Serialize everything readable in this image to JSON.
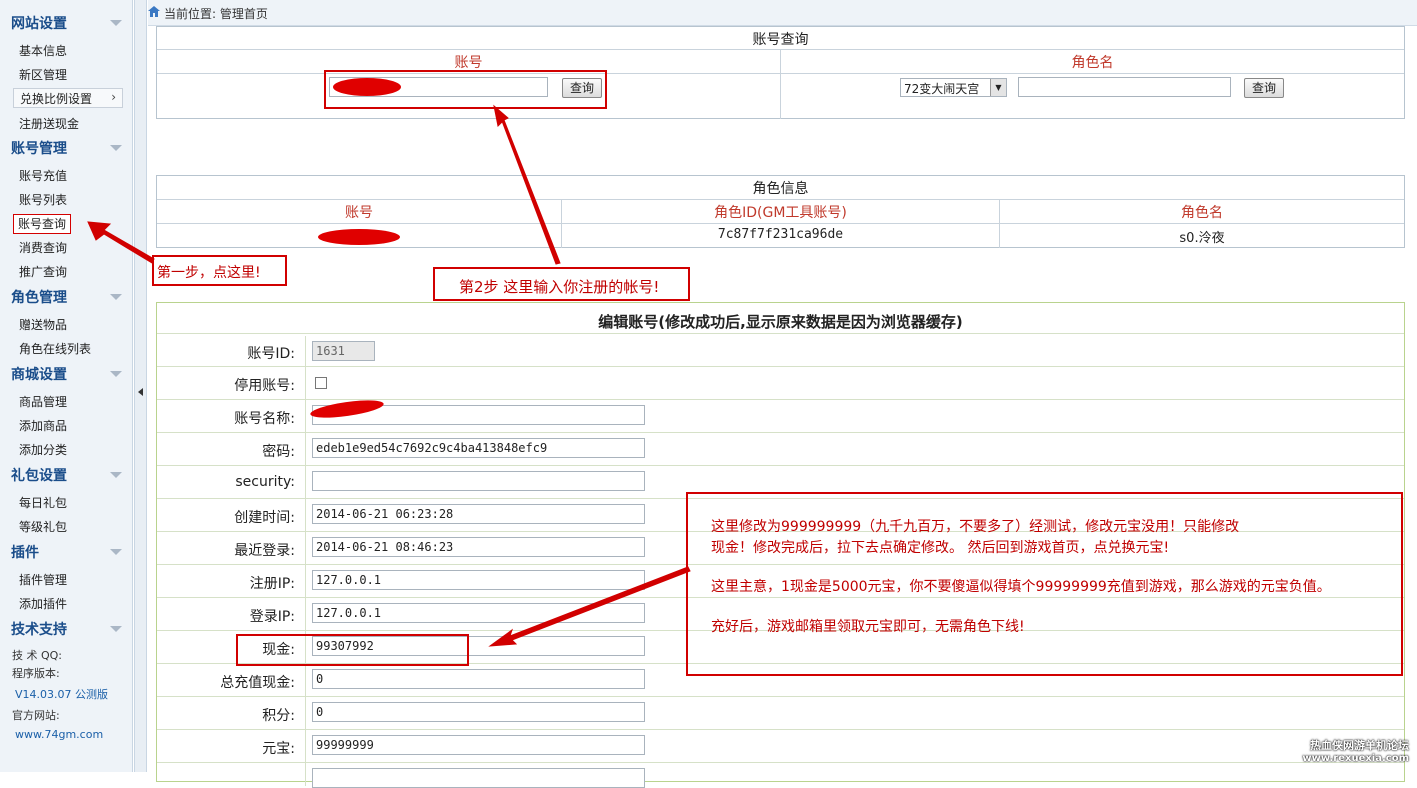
{
  "sidebar": {
    "sections": [
      {
        "title": "网站设置",
        "items": [
          "基本信息",
          "新区管理",
          "兑换比例设置",
          "注册送现金"
        ]
      },
      {
        "title": "账号管理",
        "items": [
          "账号充值",
          "账号列表",
          "账号查询",
          "消费查询",
          "推广查询"
        ]
      },
      {
        "title": "角色管理",
        "items": [
          "赠送物品",
          "角色在线列表"
        ]
      },
      {
        "title": "商城设置",
        "items": [
          "商品管理",
          "添加商品",
          "添加分类"
        ]
      },
      {
        "title": "礼包设置",
        "items": [
          "每日礼包",
          "等级礼包"
        ]
      },
      {
        "title": "插件",
        "items": [
          "插件管理",
          "添加插件"
        ]
      },
      {
        "title": "技术支持",
        "items": []
      }
    ],
    "info": {
      "qq_label": "技 术 QQ:",
      "version_label": "程序版本:",
      "version": "V14.03.07 公测版",
      "site_label": "官方网站:",
      "site": "www.74gm.com"
    }
  },
  "breadcrumb": "当前位置: 管理首页",
  "account_query": {
    "title": "账号查询",
    "col_account": "账号",
    "col_role": "角色名",
    "query_button": "查询",
    "server_select": "72变大闹天宫",
    "role_input": ""
  },
  "role_info": {
    "title": "角色信息",
    "headers": [
      "账号",
      "角色ID(GM工具账号)",
      "角色名"
    ],
    "row": {
      "account": "",
      "role_id": "7c87f7f231ca96de",
      "role_name": "s0.泠夜"
    }
  },
  "edit": {
    "title": "编辑账号(修改成功后,显示原来数据是因为浏览器缓存)",
    "fields": [
      {
        "label": "账号ID:",
        "value": "1631"
      },
      {
        "label": "停用账号:",
        "value": ""
      },
      {
        "label": "账号名称:",
        "value": ""
      },
      {
        "label": "密码:",
        "value": "edeb1e9ed54c7692c9c4ba413848efc9"
      },
      {
        "label": "security:",
        "value": ""
      },
      {
        "label": "创建时间:",
        "value": "2014-06-21 06:23:28"
      },
      {
        "label": "最近登录:",
        "value": "2014-06-21 08:46:23"
      },
      {
        "label": "注册IP:",
        "value": "127.0.0.1"
      },
      {
        "label": "登录IP:",
        "value": "127.0.0.1"
      },
      {
        "label": "现金:",
        "value": "99307992"
      },
      {
        "label": "总充值现金:",
        "value": "0"
      },
      {
        "label": "积分:",
        "value": "0"
      },
      {
        "label": "元宝:",
        "value": "99999999"
      }
    ]
  },
  "annotations": {
    "step1": "第一步，点这里!",
    "step2": "第2步  这里输入你注册的帐号!",
    "note_line1": "这里修改为999999999（九千九百万，不要多了）经测试，修改元宝没用！只能修改",
    "note_line2": "现金！修改完成后，拉下去点确定修改。 然后回到游戏首页，点兑换元宝!",
    "note_line3": "这里主意，1现金是5000元宝，你不要傻逼似得填个99999999充值到游戏，那么游戏的元宝负值。",
    "note_line4": "充好后，游戏邮箱里领取元宝即可，无需角色下线!"
  },
  "watermark": {
    "line1": "热血侠网游单机论坛",
    "line2": "www.rexuexia.com"
  },
  "colors": {
    "annotation_red": "#d10000",
    "header_red": "#c0392b",
    "section_blue": "#1a4d8a"
  }
}
